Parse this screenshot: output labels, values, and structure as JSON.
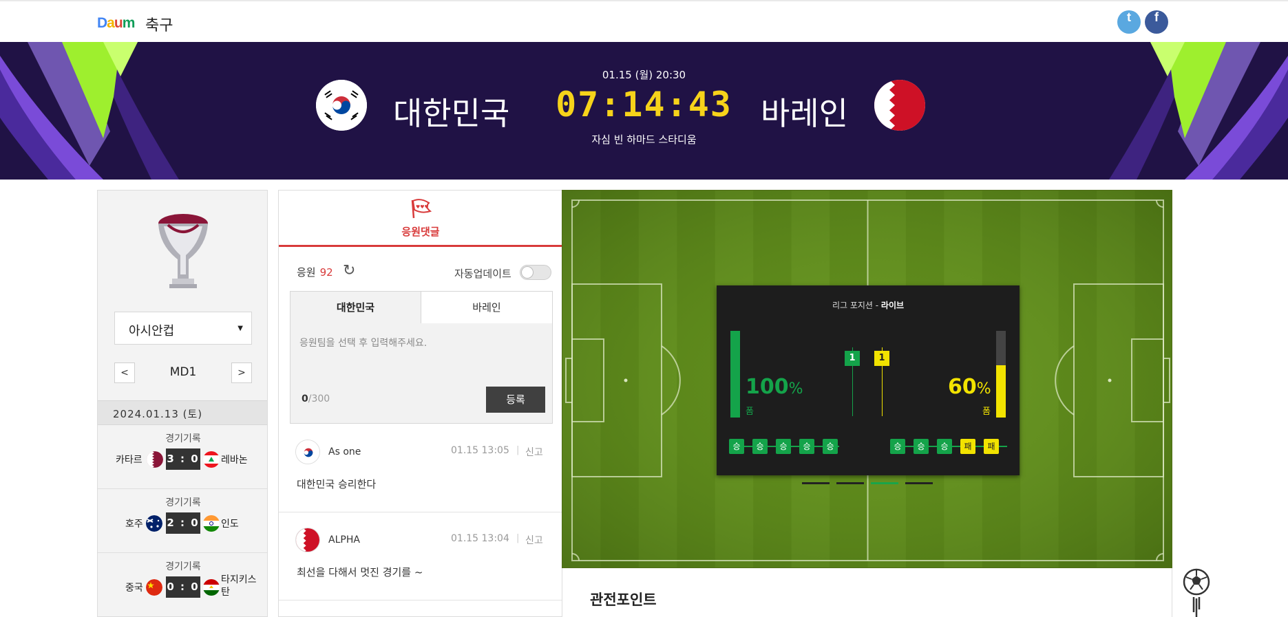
{
  "header": {
    "logo_text": "Daum",
    "section": "축구",
    "social": {
      "twitter": "t",
      "facebook": "f"
    }
  },
  "match": {
    "datetime": "01.15 (월) 20:30",
    "home_team": "대한민국",
    "away_team": "바레인",
    "countdown": "07:14:43",
    "stadium": "자심 빈 하마드 스타디움"
  },
  "sidebar": {
    "league": "아시안컵",
    "round": "MD1",
    "prev": "<",
    "next": ">",
    "date": "2024.01.13 (토)",
    "matches": [
      {
        "caption": "경기기록",
        "home": "카타르",
        "home_score": "3",
        "away_score": "0",
        "away": "레바논"
      },
      {
        "caption": "경기기록",
        "home": "호주",
        "home_score": "2",
        "away_score": "0",
        "away": "인도"
      },
      {
        "caption": "경기기록",
        "home": "중국",
        "home_score": "0",
        "away_score": "0",
        "away": "타지키스탄"
      }
    ]
  },
  "cheer": {
    "tab_label": "응원댓글",
    "count_label": "응원",
    "count": "92",
    "auto_update": "자동업데이트",
    "auto_update_on": false,
    "team_tabs": [
      "대한민국",
      "바레인"
    ],
    "selected_team": "대한민국",
    "placeholder": "응원팀을 선택 후 입력해주세요.",
    "char_count": "0",
    "char_limit": "/300",
    "submit": "등록",
    "comments": [
      {
        "user": "As one",
        "team": "korea",
        "time": "01.15 13:05",
        "report": "신고",
        "text": "대한민국 승리한다"
      },
      {
        "user": "ALPHA",
        "team": "bahrain",
        "time": "01.15 13:04",
        "report": "신고",
        "text": "최선을 다해서 멋진 경기를 ~"
      }
    ]
  },
  "league_position": {
    "title": "리그 포지션",
    "title_suffix": "라이브",
    "home": {
      "form_pct": "100",
      "form_label": "폼",
      "form_fraction": 1.0,
      "position": "1",
      "results": [
        "승",
        "승",
        "승",
        "승",
        "승"
      ]
    },
    "away": {
      "form_pct": "60",
      "form_label": "폼",
      "form_fraction": 0.6,
      "position": "1",
      "results": [
        "승",
        "승",
        "승",
        "패",
        "패"
      ]
    },
    "pct_unit": "%",
    "slides": 4,
    "active_slide": 3
  },
  "viewpoint": {
    "title": "관전포인트"
  },
  "colors": {
    "hero_bg": "#201245",
    "accent_red": "#d83a3a",
    "win": "#14a34a",
    "loss": "#f2e300",
    "countdown": "#f6d31a"
  }
}
